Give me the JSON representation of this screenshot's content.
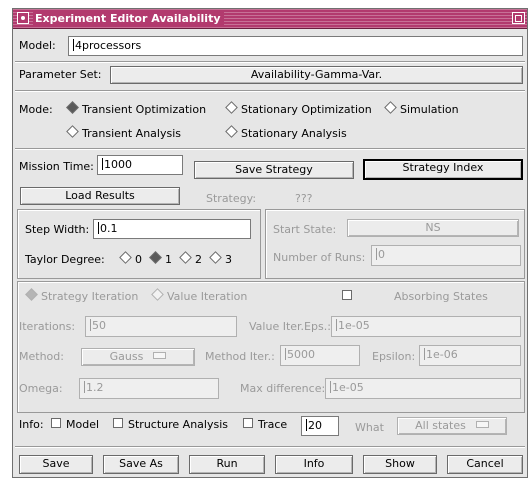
{
  "window": {
    "title": "Experiment Editor  Availability"
  },
  "model": {
    "label": "Model:",
    "value": "4processors"
  },
  "parameter_set": {
    "label": "Parameter Set:",
    "value": "Availability-Gamma-Var."
  },
  "mode": {
    "label": "Mode:",
    "options": [
      {
        "label": "Transient Optimization",
        "selected": true
      },
      {
        "label": "Stationary Optimization",
        "selected": false
      },
      {
        "label": "Simulation",
        "selected": false
      },
      {
        "label": "Transient Analysis",
        "selected": false
      },
      {
        "label": "Stationary Analysis",
        "selected": false
      }
    ]
  },
  "mission_time": {
    "label": "Mission Time:",
    "value": "1000"
  },
  "buttons": {
    "save_strategy": "Save Strategy",
    "strategy_index": "Strategy Index",
    "load_results": "Load Results"
  },
  "strategy": {
    "label": "Strategy:",
    "value": "???"
  },
  "step_width": {
    "label": "Step Width:",
    "value": "0.1"
  },
  "taylor_degree": {
    "label": "Taylor Degree:",
    "options": [
      "0",
      "1",
      "2",
      "3"
    ],
    "selected": "1"
  },
  "start_state": {
    "label": "Start State:",
    "value": "NS"
  },
  "number_of_runs": {
    "label": "Number of Runs:",
    "value": "0"
  },
  "iteration": {
    "method_options": [
      "Strategy Iteration",
      "Value Iteration"
    ],
    "selected": "Strategy Iteration",
    "absorbing_states_label": "Absorbing States",
    "iterations_label": "Iterations:",
    "iterations_value": "50",
    "value_iter_eps_label": "Value Iter.Eps.:",
    "value_iter_eps_value": "1e-05",
    "method_label": "Method:",
    "method_value": "Gauss",
    "method_iter_label": "Method Iter.:",
    "method_iter_value": "5000",
    "epsilon_label": "Epsilon:",
    "epsilon_value": "1e-06",
    "omega_label": "Omega:",
    "omega_value": "1.2",
    "max_difference_label": "Max difference:",
    "max_difference_value": "1e-05"
  },
  "info": {
    "label": "Info:",
    "model_label": "Model",
    "structure_label": "Structure Analysis",
    "trace_label": "Trace",
    "trace_value": "20",
    "what_label": "What",
    "what_value": "All states"
  },
  "footer": [
    "Save",
    "Save As",
    "Run",
    "Info",
    "Show",
    "Cancel"
  ]
}
